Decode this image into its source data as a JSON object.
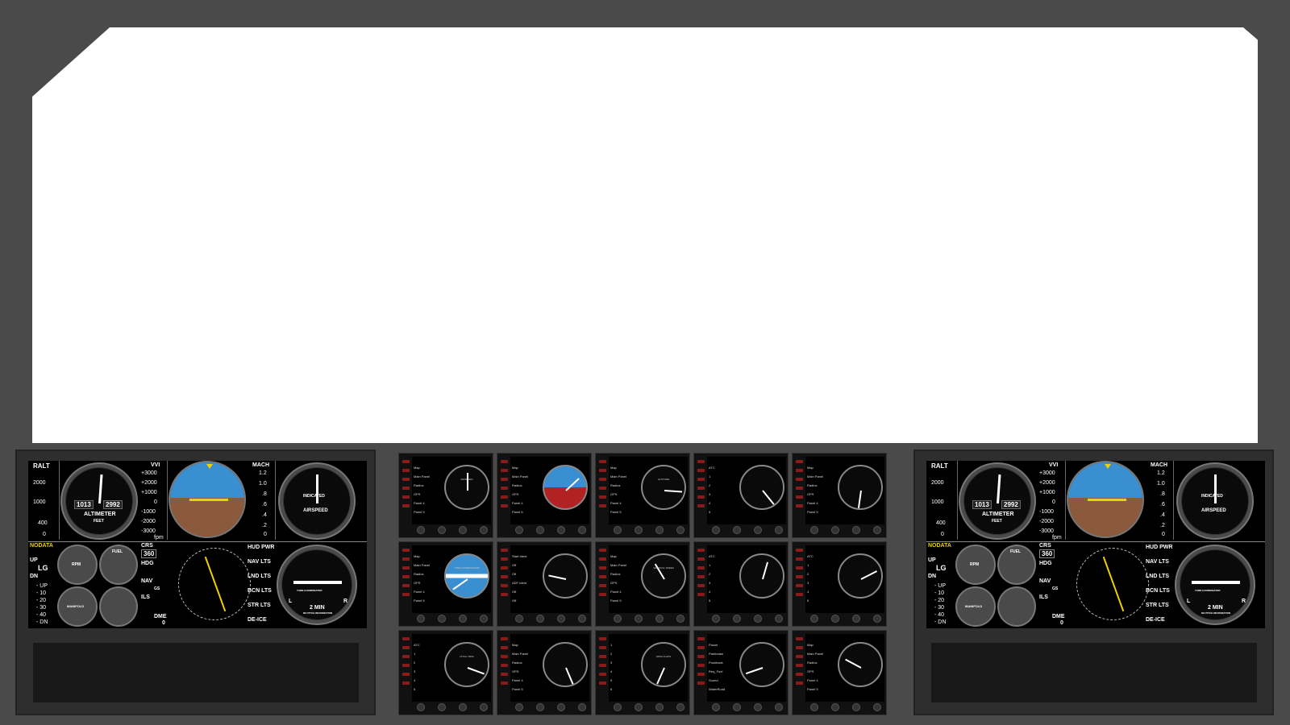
{
  "panels": {
    "left": {
      "tape_labels": {
        "ralt": "RALT",
        "vvi": "VVI",
        "mach": "MACH",
        "crs": "CRS",
        "crs_value": "360",
        "hdg": "HDG",
        "nav": "NAV",
        "gs": "GS",
        "ils": "ILS",
        "dme": "DME",
        "dme_value": "0",
        "fpm": "fpm",
        "up": "UP",
        "dn": "DN"
      },
      "ralt_scale": [
        "2000",
        "1000",
        "400",
        "0"
      ],
      "vvi_scale": [
        "+3000",
        "+2000",
        "+1000",
        "0",
        "-1000",
        "-2000",
        "-3000"
      ],
      "mach_scale": [
        "1.2",
        "1.0",
        ".8",
        ".6",
        ".4",
        ".2",
        "0"
      ],
      "altimeter": {
        "baro": "1013",
        "alt": "2992",
        "label": "ALTIMETER",
        "unit": "FEET"
      },
      "airspeed": {
        "label": "AIRSPEED",
        "sub": "INDICATED"
      },
      "status": {
        "nodata": "NODATA",
        "lg": "LG",
        "up": "UP",
        "dn": "DN"
      },
      "flaps": [
        "- UP",
        "- 10",
        "- 20",
        "- 30",
        "- 40",
        "- DN"
      ],
      "flaps_label": "FLAPS",
      "engine": {
        "rpm": "RPM",
        "fuel": "FUEL",
        "manifold": "MANIFOLD"
      },
      "switches": [
        "HUD PWR",
        "NAV LTS",
        "LND LTS",
        "BCN LTS",
        "STR LTS",
        "DE-ICE"
      ],
      "turn_coordinator": {
        "label": "TURN COORDINATOR",
        "l": "L",
        "r": "R",
        "min": "2 MIN",
        "info": "NO PITCH INFORMATION"
      }
    },
    "right": {
      "tape_labels": {
        "ralt": "RALT",
        "vvi": "VVI",
        "mach": "MACH",
        "crs": "CRS",
        "crs_value": "360",
        "hdg": "HDG",
        "nav": "NAV",
        "gs": "GS",
        "ils": "ILS",
        "dme": "DME",
        "dme_value": "0",
        "fpm": "fpm",
        "up": "UP",
        "dn": "DN"
      },
      "ralt_scale": [
        "2000",
        "1000",
        "400",
        "0"
      ],
      "vvi_scale": [
        "+3000",
        "+2000",
        "+1000",
        "0",
        "-1000",
        "-2000",
        "-3000"
      ],
      "mach_scale": [
        "1.2",
        "1.0",
        ".8",
        ".6",
        ".4",
        ".2",
        "0"
      ],
      "altimeter": {
        "baro": "1013",
        "alt": "2992",
        "label": "ALTIMETER",
        "unit": "FEET"
      },
      "airspeed": {
        "label": "AIRSPEED",
        "sub": "INDICATED"
      },
      "status": {
        "nodata": "NODATA",
        "lg": "LG",
        "up": "UP",
        "dn": "DN"
      },
      "flaps": [
        "- UP",
        "- 10",
        "- 20",
        "- 30",
        "- 40",
        "- DN"
      ],
      "flaps_label": "FLAPS",
      "engine": {
        "rpm": "RPM",
        "fuel": "FUEL",
        "manifold": "MANIFOLD"
      },
      "switches": [
        "HUD PWR",
        "NAV LTS",
        "LND LTS",
        "BCN LTS",
        "STR LTS",
        "DE-ICE"
      ],
      "turn_coordinator": {
        "label": "TURN COORDINATOR",
        "l": "L",
        "r": "R",
        "min": "2 MIN",
        "info": "NO PITCH INFORMATION"
      }
    }
  },
  "instrument_panels": [
    {
      "menu": [
        "Map",
        "Main Panel",
        "Radios",
        "GPS",
        "Panel 4",
        "Panel 5"
      ],
      "gauge": "airspeed",
      "title": "AIRSPEED"
    },
    {
      "menu": [
        "Map",
        "Main Panel",
        "Radios",
        "GPS",
        "Panel 4",
        "Panel 5"
      ],
      "gauge": "attitude",
      "title": ""
    },
    {
      "menu": [
        "Map",
        "Main Panel",
        "Radios",
        "GPS",
        "Panel 4",
        "Panel 5"
      ],
      "gauge": "altimeter",
      "title": "ALTITUDE"
    },
    {
      "menu": [
        "ATC",
        "1",
        "2",
        "3",
        "4",
        "5"
      ],
      "gauge": "adf",
      "title": ""
    },
    {
      "menu": [
        "Map",
        "Main Panel",
        "Radios",
        "GPS",
        "Panel 4",
        "Panel 5"
      ],
      "gauge": "vor",
      "title": ""
    },
    {
      "menu": [
        "Map",
        "Main Panel",
        "Radios",
        "GPS",
        "Panel 4",
        "Panel 5"
      ],
      "gauge": "turn",
      "title": "TURN COORDINATOR"
    },
    {
      "menu": [
        "Start Ident",
        "Off",
        "Off",
        "ADF Ident",
        "Off",
        "Off"
      ],
      "gauge": "heading",
      "title": ""
    },
    {
      "menu": [
        "Map",
        "Main Panel",
        "Radios",
        "GPS",
        "Panel 4",
        "Panel 5"
      ],
      "gauge": "vsi",
      "title": "VERTICAL SPEED"
    },
    {
      "menu": [
        "ATC",
        "1",
        "2",
        "3",
        "4",
        "5"
      ],
      "gauge": "obs",
      "title": ""
    },
    {
      "menu": [
        "ATC",
        "1",
        "2",
        "3",
        "4",
        "5"
      ],
      "gauge": "engine",
      "title": ""
    },
    {
      "menu": [
        "ATC",
        "1",
        "2",
        "3",
        "4",
        "5"
      ],
      "gauge": "trim",
      "title": "PITCH TRIM"
    },
    {
      "menu": [
        "Map",
        "Main Panel",
        "Radios",
        "GPS",
        "Panel 4",
        "Panel 5"
      ],
      "gauge": "rpm",
      "title": ""
    },
    {
      "menu": [
        "1",
        "2",
        "3",
        "4",
        "5",
        "6"
      ],
      "gauge": "flaps",
      "title": "WING FLAPS"
    },
    {
      "menu": [
        "Pause",
        "Parkbrake",
        "Pushback",
        "Req_Fuel",
        "Sound",
        "WaterRudd"
      ],
      "gauge": "compass",
      "title": ""
    },
    {
      "menu": [
        "Map",
        "Main Panel",
        "Radios",
        "GPS",
        "Panel 4",
        "Panel 5"
      ],
      "gauge": "multi",
      "title": ""
    }
  ],
  "colors": {
    "sky": "#3a8fd0",
    "ground": "#8b5a3c",
    "accent_yellow": "#f0d000",
    "button_red": "#8b1a1a"
  }
}
